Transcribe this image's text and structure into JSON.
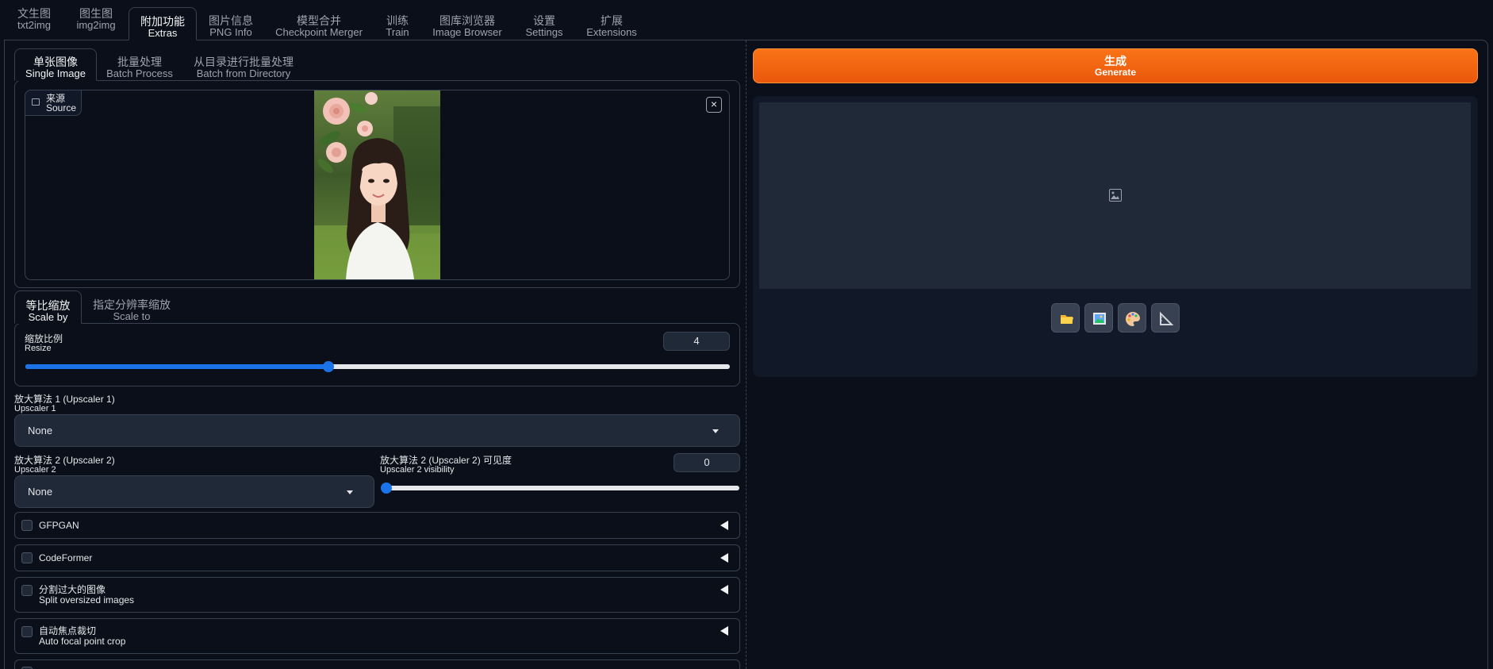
{
  "top_tabs": [
    {
      "zh": "文生图",
      "en": "txt2img"
    },
    {
      "zh": "图生图",
      "en": "img2img"
    },
    {
      "zh": "附加功能",
      "en": "Extras"
    },
    {
      "zh": "图片信息",
      "en": "PNG Info"
    },
    {
      "zh": "模型合并",
      "en": "Checkpoint Merger"
    },
    {
      "zh": "训练",
      "en": "Train"
    },
    {
      "zh": "图库浏览器",
      "en": "Image Browser"
    },
    {
      "zh": "设置",
      "en": "Settings"
    },
    {
      "zh": "扩展",
      "en": "Extensions"
    }
  ],
  "active_top_tab": "Extras",
  "mode_tabs": [
    {
      "zh": "单张图像",
      "en": "Single Image"
    },
    {
      "zh": "批量处理",
      "en": "Batch Process"
    },
    {
      "zh": "从目录进行批量处理",
      "en": "Batch from Directory"
    }
  ],
  "source": {
    "zh": "来源",
    "en": "Source",
    "close_glyph": "×"
  },
  "scale_tabs": [
    {
      "zh": "等比缩放",
      "en": "Scale by"
    },
    {
      "zh": "指定分辨率缩放",
      "en": "Scale to"
    }
  ],
  "resize": {
    "zh": "缩放比例",
    "en": "Resize",
    "value": "4",
    "fraction": 0.43
  },
  "upscaler1": {
    "zh": "放大算法 1 (Upscaler 1)",
    "en": "Upscaler 1",
    "value": "None"
  },
  "upscaler2": {
    "zh": "放大算法 2 (Upscaler 2)",
    "en": "Upscaler 2",
    "value": "None"
  },
  "upscaler2_visibility": {
    "zh": "放大算法 2 (Upscaler 2) 可见度",
    "en": "Upscaler 2 visibility",
    "value": "0",
    "fraction": 0
  },
  "accordions": [
    {
      "zh": "GFPGAN",
      "en": ""
    },
    {
      "zh": "CodeFormer",
      "en": ""
    },
    {
      "zh": "分割过大的图像",
      "en": "Split oversized images"
    },
    {
      "zh": "自动焦点裁切",
      "en": "Auto focal point crop"
    }
  ],
  "generate": {
    "zh": "生成",
    "en": "Generate"
  },
  "colors": {
    "accent_orange": "#ea580c",
    "slider_blue": "#1a73e8",
    "background": "#0b0f19"
  },
  "tool_icons": [
    "folder-icon",
    "image-icon",
    "palette-icon",
    "ruler-icon"
  ]
}
